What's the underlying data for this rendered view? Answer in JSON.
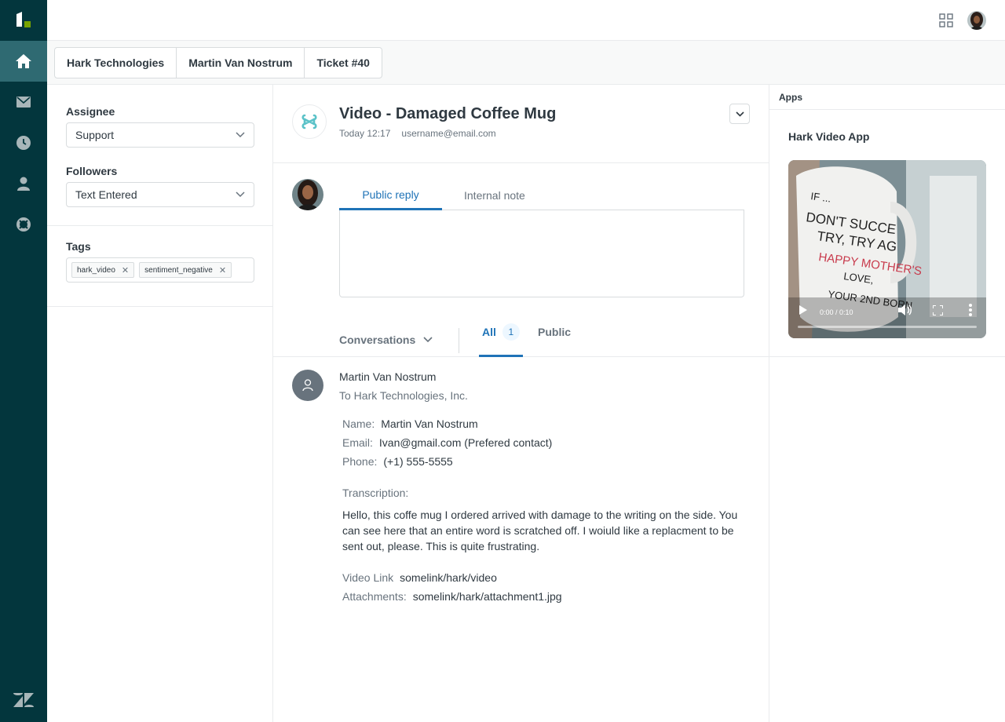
{
  "nav": {
    "items": [
      "home",
      "inbox",
      "history",
      "user",
      "support"
    ],
    "active": "home"
  },
  "breadcrumb": [
    "Hark Technologies",
    "Martin Van Nostrum",
    "Ticket #40"
  ],
  "properties": {
    "assignee_label": "Assignee",
    "assignee_value": "Support",
    "followers_label": "Followers",
    "followers_value": "Text Entered",
    "tags_label": "Tags",
    "tags": [
      "hark_video",
      "sentiment_negative"
    ]
  },
  "ticket": {
    "title": "Video - Damaged Coffee Mug",
    "time": "Today 12:17",
    "email": "username@email.com"
  },
  "reply": {
    "tab_public": "Public reply",
    "tab_internal": "Internal note"
  },
  "conversations": {
    "label": "Conversations",
    "filter_all": "All",
    "all_count": "1",
    "filter_public": "Public"
  },
  "message": {
    "author": "Martin Van Nostrum",
    "to": "To Hark Technologies, Inc.",
    "name_key": "Name:",
    "name_val": "Martin Van Nostrum",
    "email_key": "Email:",
    "email_val": "Ivan@gmail.com (Prefered contact)",
    "phone_key": "Phone:",
    "phone_val": "(+1) 555-5555",
    "transcription_label": "Transcription:",
    "transcription": "Hello, this coffe mug I ordered arrived with damage to the writing on the side. You can see here  that an entire word is scratched off. I woiuld like a replacment to be sent out, please. This is quite frustrating.",
    "video_key": "Video Link",
    "video_val": "somelink/hark/video",
    "attach_key": "Attachments:",
    "attach_val": "somelink/hark/attachment1.jpg"
  },
  "apps": {
    "header": "Apps",
    "app_title": "Hark Video App",
    "video_time": "0:00 / 0:10",
    "mug_lines": [
      "IF ...",
      "DON'T SUCCE",
      "TRY, TRY AG",
      "HAPPY MOTHER'S",
      "LOVE,",
      "YOUR 2ND BORN"
    ]
  },
  "colors": {
    "nav_bg": "#03363d",
    "accent": "#1f73b7",
    "text": "#2f3941",
    "muted": "#68737d"
  }
}
